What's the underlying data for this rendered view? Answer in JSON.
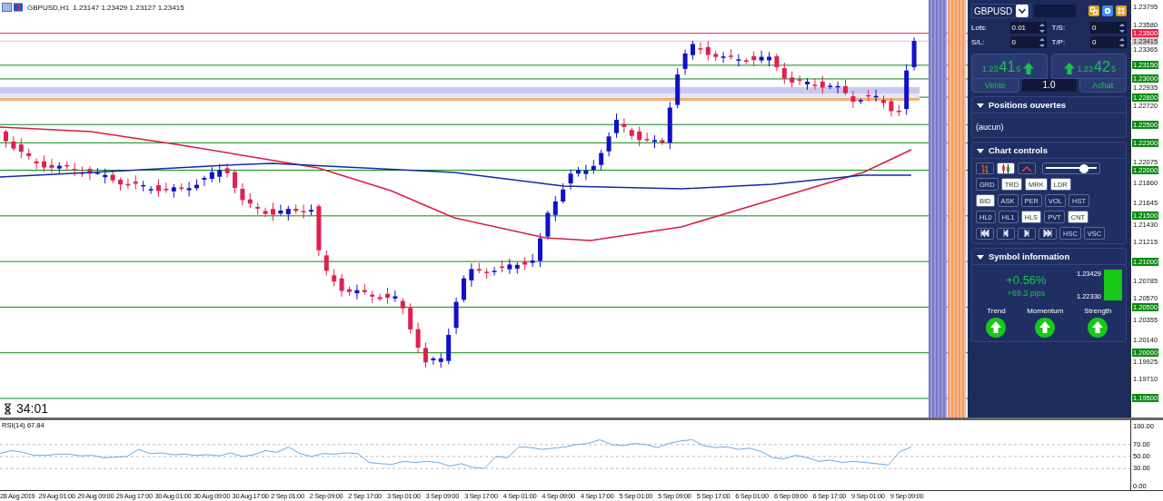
{
  "window": {
    "title": "GBPUSD,H1",
    "ohlc": "1.23147 1.23429 1.23127 1.23415"
  },
  "chart": {
    "countdown": "34:01",
    "price_ticks": [
      "1.23795",
      "1.23580",
      "1.23365",
      "1.22935",
      "1.22720",
      "1.22075",
      "1.21860",
      "1.21645",
      "1.21430",
      "1.21215",
      "1.20785",
      "1.20570",
      "1.20355",
      "1.20140",
      "1.19925",
      "1.19710"
    ],
    "price_badges": [
      {
        "text": "1.23500",
        "kind": "alert",
        "color": "#e8204c"
      },
      {
        "text": "1.23415",
        "kind": "bid",
        "color": "#cfcfcf"
      },
      {
        "text": "1.23150",
        "kind": "level",
        "color": "#0a8a14"
      },
      {
        "text": "1.23000",
        "kind": "level",
        "color": "#0a8a14"
      },
      {
        "text": "1.22800",
        "kind": "level",
        "color": "#0a8a14"
      },
      {
        "text": "1.22500",
        "kind": "level",
        "color": "#0a8a14"
      },
      {
        "text": "1.22300",
        "kind": "level",
        "color": "#0a8a14"
      },
      {
        "text": "1.22000",
        "kind": "level",
        "color": "#0a8a14"
      },
      {
        "text": "1.21500",
        "kind": "level",
        "color": "#0a8a14"
      },
      {
        "text": "1.21000",
        "kind": "level",
        "color": "#0a8a14"
      },
      {
        "text": "1.20500",
        "kind": "level",
        "color": "#0a8a14"
      },
      {
        "text": "1.20000",
        "kind": "level",
        "color": "#0a8a14"
      },
      {
        "text": "1.19500",
        "kind": "level",
        "color": "#0a8a14"
      }
    ]
  },
  "rsi": {
    "chart_data": {
      "type": "line",
      "title": "RSI(14) 67.84",
      "ylim": [
        0,
        100
      ],
      "grid": true,
      "yticks": [
        {
          "value": 100,
          "label": "100.00"
        },
        {
          "value": 70,
          "label": "70.00"
        },
        {
          "value": 50,
          "label": "50.00"
        },
        {
          "value": 30,
          "label": "30.00"
        },
        {
          "value": 0,
          "label": "0.00"
        }
      ],
      "series": [
        {
          "color": "#6aaae6",
          "values": [
            55,
            60,
            57,
            52,
            52,
            54,
            54,
            51,
            52,
            48,
            49,
            50,
            62,
            55,
            56,
            53,
            54,
            52,
            53,
            51,
            56,
            50,
            53,
            60,
            57,
            66,
            55,
            50,
            55,
            54,
            56,
            55,
            40,
            38,
            37,
            42,
            40,
            42,
            40,
            34,
            38,
            32,
            30,
            50,
            48,
            66,
            65,
            62,
            64,
            66,
            70,
            72,
            78,
            70,
            68,
            72,
            70,
            65,
            72,
            76,
            78,
            68,
            65,
            66,
            62,
            64,
            58,
            48,
            46,
            52,
            48,
            42,
            44,
            40,
            42,
            40,
            38,
            36,
            58,
            66
          ]
        }
      ]
    }
  },
  "time_labels": [
    "28 Aug 2019",
    "29 Aug 01:00",
    "29 Aug 09:00",
    "29 Aug 17:00",
    "30 Aug 01:00",
    "30 Aug 09:00",
    "30 Aug 17:00",
    "2 Sep 01:00",
    "2 Sep 09:00",
    "2 Sep 17:00",
    "3 Sep 01:00",
    "3 Sep 09:00",
    "3 Sep 17:00",
    "4 Sep 01:00",
    "4 Sep 09:00",
    "4 Sep 17:00",
    "5 Sep 01:00",
    "5 Sep 09:00",
    "5 Sep 17:00",
    "6 Sep 01:00",
    "6 Sep 09:00",
    "6 Sep 17:00",
    "9 Sep 01:00",
    "9 Sep 09:00"
  ],
  "panel": {
    "symbol": "GBPUSD",
    "fields": [
      {
        "label": "Lots:",
        "value": "0.01"
      },
      {
        "label": "T/S:",
        "value": "0"
      },
      {
        "label": "S/L:",
        "value": "0"
      },
      {
        "label": "T/P:",
        "value": "0"
      }
    ],
    "sell": {
      "label": "Vente",
      "prefix": "1.23",
      "pips": "41",
      "fraction": "5"
    },
    "buy": {
      "label": "Achat",
      "prefix": "1.23",
      "pips": "42",
      "fraction": "5"
    },
    "volume": "1.0",
    "positions": {
      "title": "Positions ouvertes",
      "expanded": true,
      "text": "(aucun)"
    },
    "chart_controls": {
      "title": "Chart controls",
      "expanded": true,
      "chart_types": [
        {
          "kind": "bars",
          "selected": false
        },
        {
          "kind": "candles",
          "selected": true
        },
        {
          "kind": "line",
          "selected": false
        }
      ],
      "slider": {
        "level": 0.72
      },
      "button_rows": [
        [
          {
            "kind": "text",
            "label": "GRD",
            "selected": false
          },
          {
            "kind": "text",
            "label": "TRD",
            "selected": true
          },
          {
            "kind": "text",
            "label": "MRK",
            "selected": true
          },
          {
            "kind": "text",
            "label": "LDR",
            "selected": true
          }
        ],
        [
          {
            "kind": "text",
            "label": "BID",
            "selected": true
          },
          {
            "kind": "text",
            "label": "ASK",
            "selected": false
          },
          {
            "kind": "text",
            "label": "PER",
            "selected": false
          },
          {
            "kind": "text",
            "label": "VOL",
            "selected": false
          },
          {
            "kind": "text",
            "label": "HST",
            "selected": false
          }
        ],
        [
          {
            "kind": "text",
            "label": "HL0",
            "selected": false
          },
          {
            "kind": "text",
            "label": "HL1",
            "selected": false
          },
          {
            "kind": "text",
            "label": "HLS",
            "selected": true
          },
          {
            "kind": "text",
            "label": "PVT",
            "selected": false
          },
          {
            "kind": "text",
            "label": "CNT",
            "selected": true
          }
        ],
        [
          {
            "kind": "first",
            "selected": false
          },
          {
            "kind": "prev",
            "selected": false
          },
          {
            "kind": "next",
            "selected": false
          },
          {
            "kind": "last",
            "selected": false
          },
          {
            "kind": "text",
            "label": "HSC",
            "selected": false
          },
          {
            "kind": "text",
            "label": "VSC",
            "selected": false
          }
        ]
      ]
    },
    "symbol_info": {
      "title": "Symbol information",
      "expanded": true,
      "change": "+0.56%",
      "pips": "+69.3 pips",
      "high": "1.23429",
      "low": "1.22330",
      "indicators": [
        {
          "label": "Trend"
        },
        {
          "label": "Momentum"
        },
        {
          "label": "Strength"
        }
      ]
    }
  }
}
